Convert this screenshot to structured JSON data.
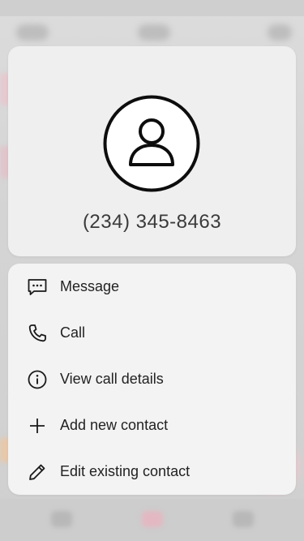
{
  "contact": {
    "phone_number": "(234) 345-8463",
    "avatar_icon": "person-icon"
  },
  "menu": {
    "items": [
      {
        "label": "Message",
        "icon": "message-icon"
      },
      {
        "label": "Call",
        "icon": "phone-icon"
      },
      {
        "label": "View call details",
        "icon": "info-icon"
      },
      {
        "label": "Add new contact",
        "icon": "plus-icon"
      },
      {
        "label": "Edit existing contact",
        "icon": "pencil-icon"
      }
    ]
  },
  "colors": {
    "card_background": "#efefef",
    "text_primary": "#222222",
    "icon": "#1a1a1a",
    "fab_accent": "#f2c6cf"
  }
}
